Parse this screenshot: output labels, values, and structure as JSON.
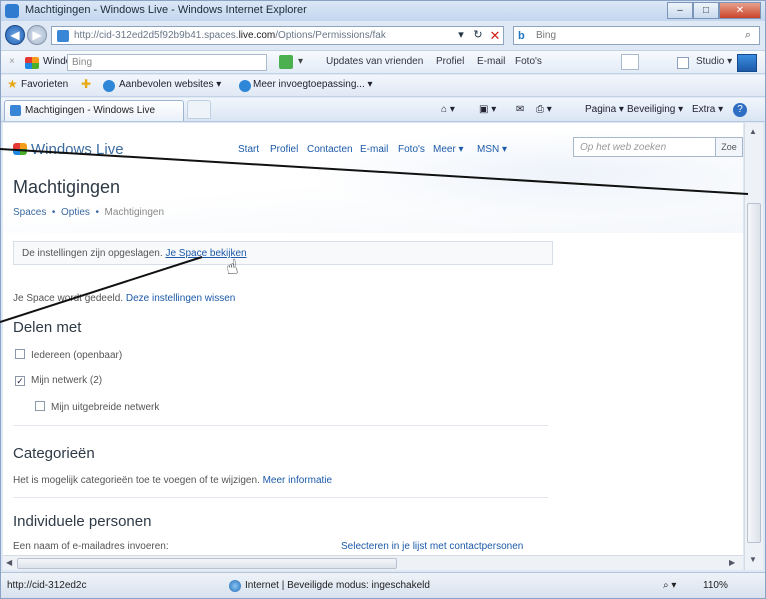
{
  "window": {
    "title": "Machtigingen - Windows Live - Windows Internet Explorer",
    "buttons": {
      "minimize": "–",
      "maximize": "□",
      "close": "✕"
    }
  },
  "address": {
    "url_prefix": "http://cid-312ed2d5f92b9b41.spaces.",
    "url_domain": "live.com",
    "url_suffix": "/Options/Permissions/fak",
    "refresh": "↻",
    "stop": "✕",
    "dropdown": "▾",
    "search_placeholder": "Bing",
    "search_icon": "b",
    "search_glyph": "⌕"
  },
  "wl_toolbar": {
    "close": "×",
    "name": "Windows Live",
    "search_value": "Bing",
    "dropdown": "▾",
    "updates": "Updates van vrienden",
    "profile": "Profiel",
    "email": "E-mail",
    "photos": "Foto's",
    "studio": "Studio ▾"
  },
  "favorites": {
    "label": "Favorieten",
    "recommended": "Aanbevolen websites ▾",
    "more": "Meer invoegtoepassing... ▾"
  },
  "tab": {
    "label": "Machtigingen - Windows Live"
  },
  "commands": {
    "page": "Pagina ▾",
    "safety": "Beveiliging ▾",
    "extra": "Extra ▾",
    "help": "?"
  },
  "site": {
    "logo": "Windows Live",
    "nav": [
      "Start",
      "Profiel",
      "Contacten",
      "E-mail",
      "Foto's",
      "Meer ▾",
      "MSN ▾"
    ],
    "search_placeholder": "Op het web zoeken",
    "search_button": "Zoe"
  },
  "page": {
    "title": "Machtigingen",
    "breadcrumb": [
      "Spaces",
      "Opties",
      "Machtigingen"
    ],
    "breadcrumb_sep": "•",
    "notice_text": "De instellingen zijn opgeslagen.",
    "notice_link": "Je Space bekijken",
    "shared_text": "Je Space wordt gedeeld.",
    "shared_link": "Deze instellingen wissen",
    "share_heading": "Delen met",
    "options": [
      {
        "label": "Iedereen (openbaar)",
        "checked": false
      },
      {
        "label": "Mijn netwerk (2)",
        "checked": true
      },
      {
        "label": "Mijn uitgebreide netwerk",
        "checked": false
      }
    ],
    "categories_heading": "Categorieën",
    "categories_text": "Het is mogelijk categorieën toe te voegen of te wijzigen.",
    "categories_link": "Meer informatie",
    "people_heading": "Individuele personen",
    "people_text": "Een naam of e-mailadres invoeren:",
    "people_link": "Selecteren in je lijst met contactpersonen"
  },
  "status": {
    "url": "http://cid-312ed2c",
    "zone": "Internet | Beveiligde modus: ingeschakeld",
    "zoom": "110%",
    "zoom_prefix": "⌕ ▾"
  }
}
